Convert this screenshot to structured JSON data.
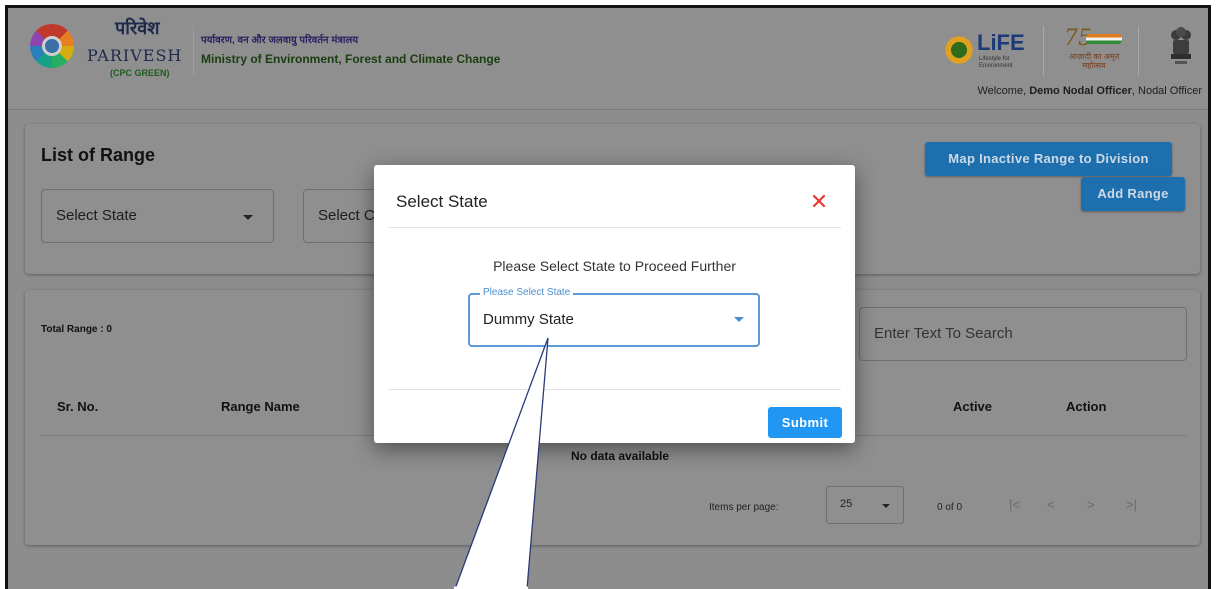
{
  "header": {
    "brand_hindi": "परिवेश",
    "brand_name": "PARIVESH",
    "brand_sub": "(CPC GREEN)",
    "ministry_hindi": "पर्यावरण, वन और जलवायु परिवर्तन मंत्रालय",
    "ministry_en": "Ministry of Environment, Forest and Climate Change",
    "life_logo": "LiFE",
    "life_sub": "Lifestyle for Environment",
    "azadi_number": "75",
    "azadi_text": "आज़ादी का अमृत महोत्सव",
    "welcome_prefix": "Welcome, ",
    "welcome_user": "Demo Nodal Officer",
    "welcome_role": ", Nodal Officer",
    "icons": [
      "parivesh-logo",
      "life-logo",
      "azadi-logo",
      "state-emblem"
    ]
  },
  "page": {
    "title": "List of Range",
    "state_select": "Select State",
    "circle_select": "Select C",
    "map_button": "Map Inactive Range to Division",
    "add_button": "Add Range"
  },
  "list": {
    "total": "Total Range : 0",
    "search_placeholder": "Enter Text To Search",
    "columns": [
      "Sr. No.",
      "Range Name",
      "Active",
      "Action"
    ],
    "empty": "No data available",
    "pager_label": "Items per page:",
    "pager_size": "25",
    "pager_range": "0 of 0",
    "nav": [
      "|<",
      "<",
      ">",
      ">|"
    ]
  },
  "modal": {
    "title": "Select State",
    "message": "Please Select State to Proceed Further",
    "field_label": "Please Select State",
    "field_value": "Dummy State",
    "submit": "Submit"
  },
  "colors": {
    "overlay": "#8f8f8f",
    "accent": "#2196f3",
    "close": "#e53935",
    "field_border": "#5a9bd5"
  }
}
